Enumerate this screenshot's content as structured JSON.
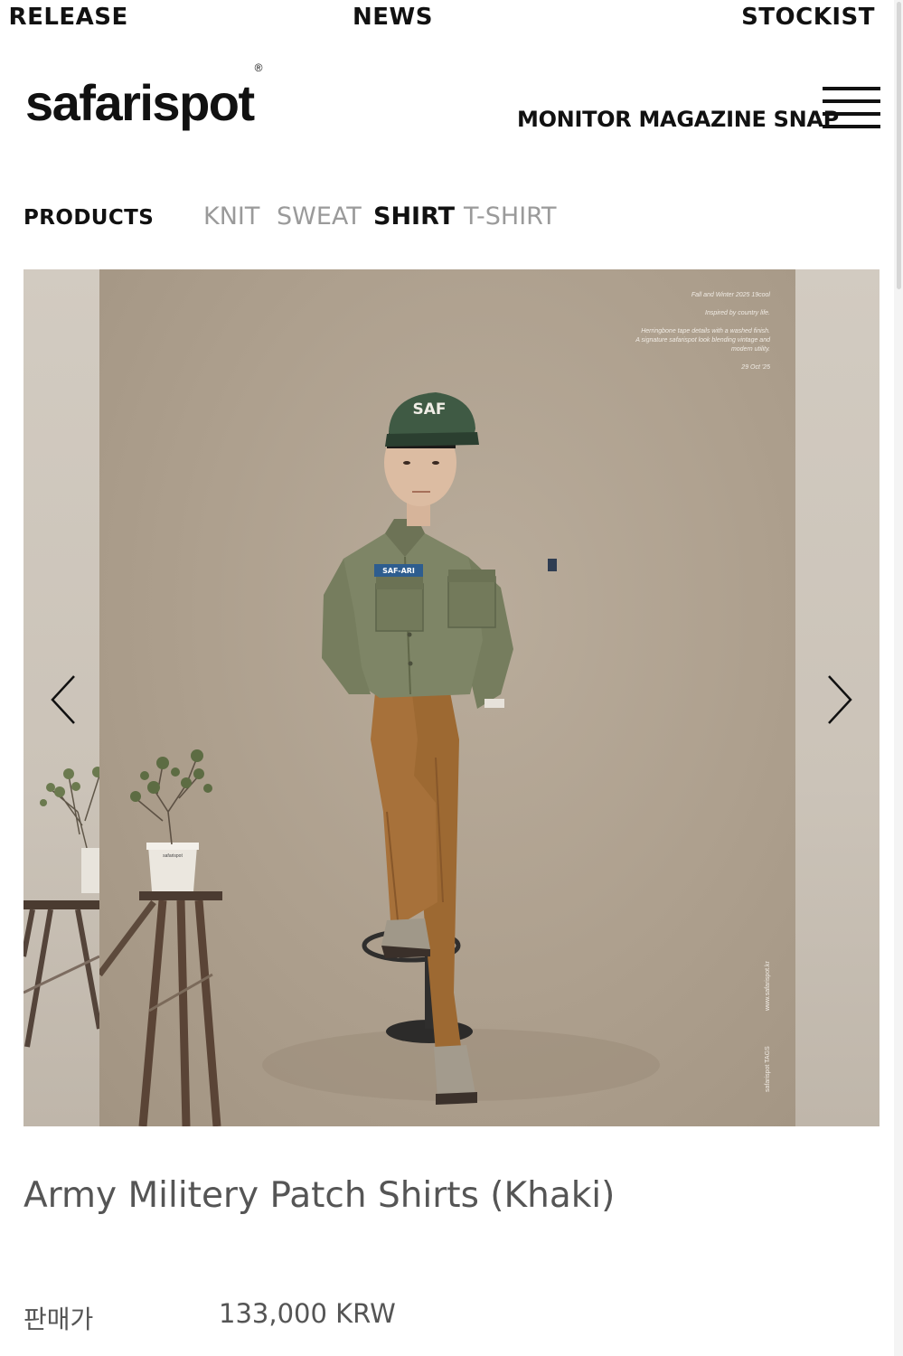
{
  "topnav": {
    "release": "/ RELEASE",
    "news": "NEWS",
    "stockist": "STOCKIST"
  },
  "header": {
    "logo": "safarispot",
    "logo_mark": "®",
    "links": [
      "MONITOR",
      "MAGAZINE",
      "SNAP"
    ],
    "menu_icon": "hamburger-icon"
  },
  "categories": {
    "title": "PRODUCTS",
    "items": [
      {
        "label": "KNIT",
        "active": false
      },
      {
        "label": "SWEAT",
        "active": false
      },
      {
        "label": "SHIRT",
        "active": true
      },
      {
        "label": "T-SHIRT",
        "active": false
      }
    ]
  },
  "gallery": {
    "prev_icon": "chevron-left-icon",
    "next_icon": "chevron-right-icon",
    "caption": {
      "line1": "Fall and Winter 2025 19cool",
      "line2": "Inspired by country life.",
      "line3": "Herringbone tape details with a washed finish.",
      "line4": "A signature safarispot look blending vintage and modern utility.",
      "date": "29 Oct '25"
    },
    "cap_text": "SAF",
    "patch_text": "SAF-ARI",
    "pot_text": "safarispot",
    "vertical_url": "www.safarispot.kr",
    "vertical_tag": "safarispot TAGS"
  },
  "product": {
    "title": "Army Militery Patch Shirts (Khaki)",
    "price_label": "판매가",
    "price_value": "133,000 KRW"
  },
  "colors": {
    "text": "#111111",
    "muted": "#9a9a9a",
    "product_text": "#555555",
    "backdrop": "#ad9f8d",
    "shirt": "#7d8464",
    "pants": "#a06a32",
    "cap": "#3f5a44"
  }
}
